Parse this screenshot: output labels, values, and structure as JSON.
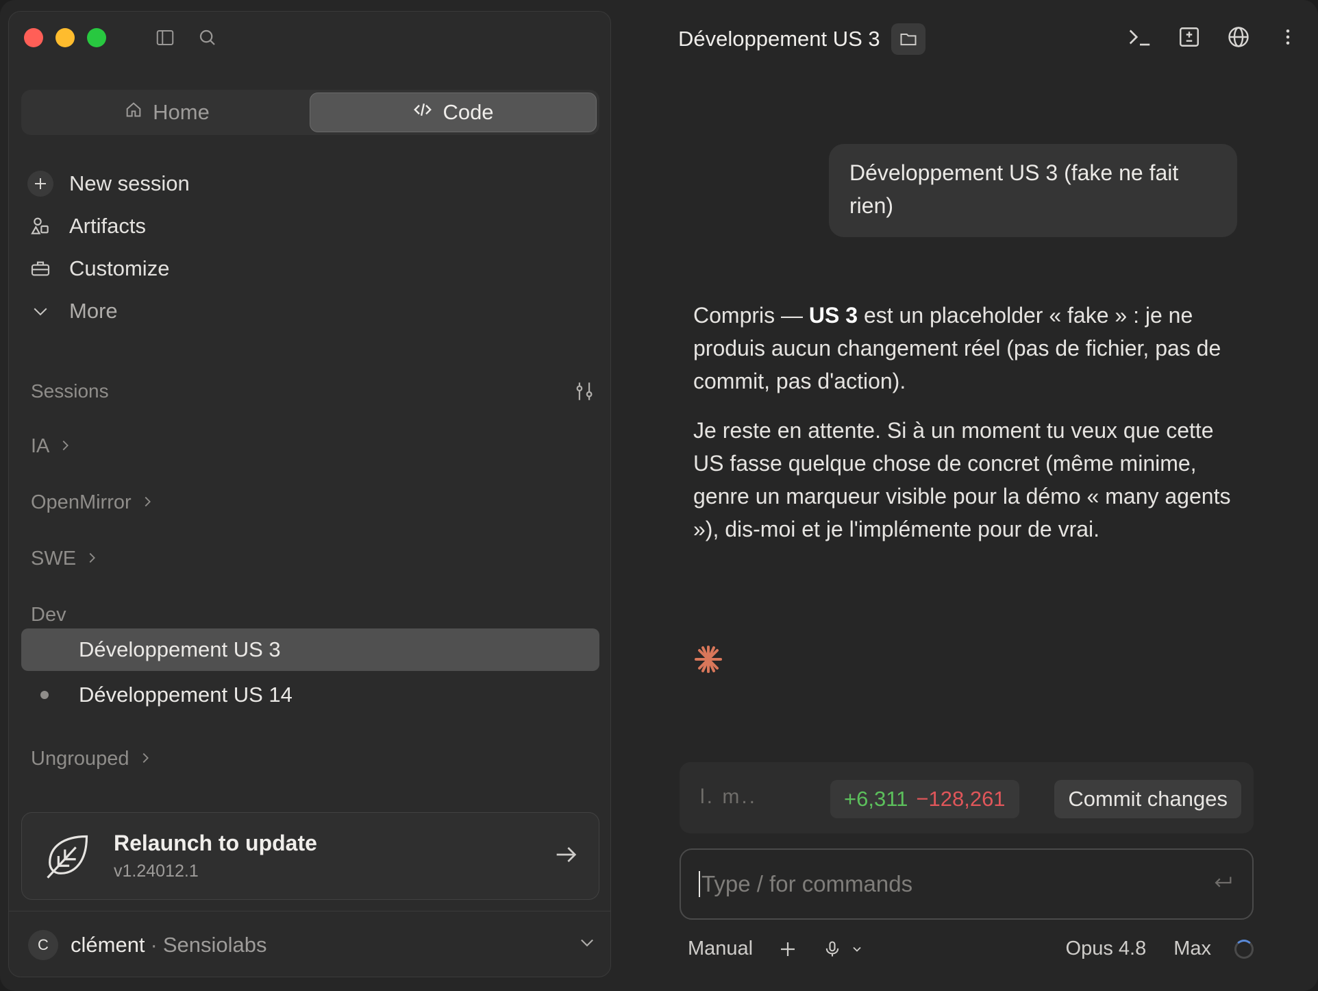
{
  "sidebar": {
    "mode_tabs": [
      {
        "label": "Home",
        "icon": "home-icon",
        "active": false
      },
      {
        "label": "Code",
        "icon": "code-icon",
        "active": true
      }
    ],
    "nav": [
      {
        "label": "New session",
        "icon": "plus-icon"
      },
      {
        "label": "Artifacts",
        "icon": "artifacts-icon"
      },
      {
        "label": "Customize",
        "icon": "briefcase-icon"
      },
      {
        "label": "More",
        "icon": "chevron-down-icon"
      }
    ],
    "sessions_label": "Sessions",
    "groups": {
      "ia": "IA",
      "openmirror": "OpenMirror",
      "swe": "SWE",
      "dev": "Dev",
      "ungrouped": "Ungrouped"
    },
    "dev_sessions": [
      {
        "label": "Développement US 3",
        "active": true
      },
      {
        "label": "Développement US 14",
        "active": false
      }
    ],
    "update": {
      "title": "Relaunch to update",
      "version": "v1.24012.1"
    },
    "user": {
      "initial": "C",
      "name": "clément",
      "separator": "·",
      "org": "Sensiolabs"
    }
  },
  "main": {
    "title": "Développement US 3",
    "user_message": "Développement US 3 (fake ne fait rien)",
    "assistant": {
      "p1_a": "Compris — ",
      "p1_bold": "US 3",
      "p1_b": " est un placeholder « fake » : je ne produis aucun changement réel (pas de fichier, pas de commit, pas d'action).",
      "p2": "Je reste en attente. Si à un moment tu veux que cette US fasse quelque chose de concret (même minime, genre un marqueur visible pour la démo « many agents »), dis-moi et je l'implémente pour de vrai."
    },
    "status": {
      "left": "l.  m..",
      "additions": "+6,311",
      "deletions": "−128,261",
      "commit_label": "Commit changes"
    },
    "input": {
      "placeholder": "Type / for commands"
    },
    "bottom": {
      "mode": "Manual",
      "model": "Opus 4.8",
      "effort": "Max"
    }
  },
  "colors": {
    "accent_spark": "#d9775a",
    "additions": "#5cc05c",
    "deletions": "#e0565a"
  }
}
